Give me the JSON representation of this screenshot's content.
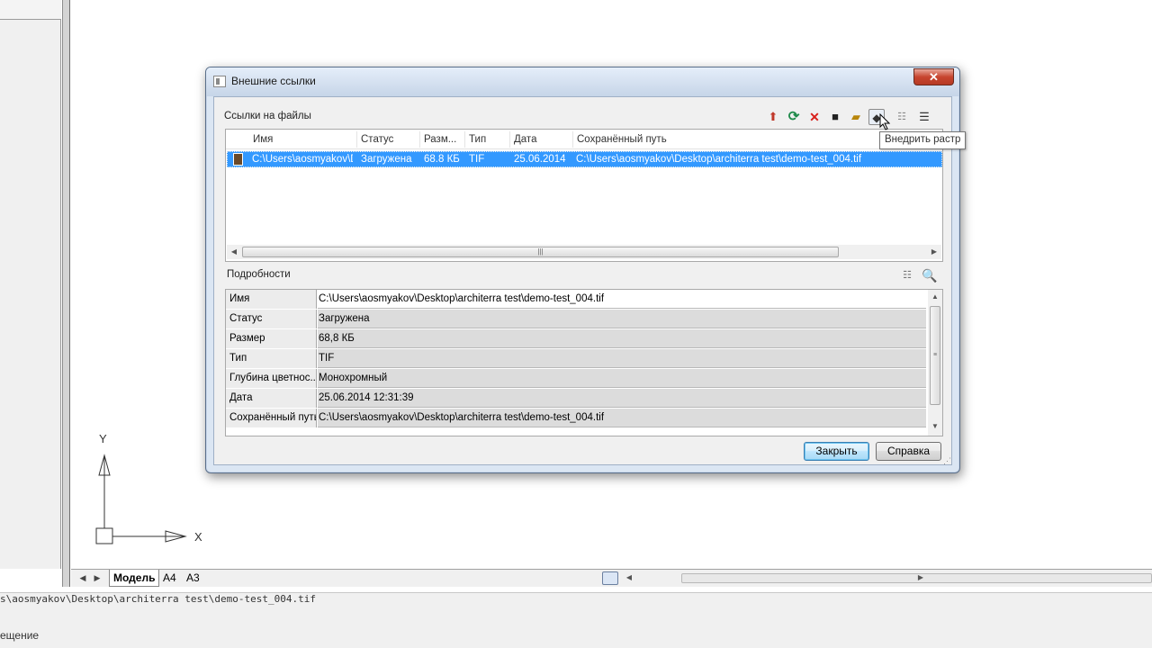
{
  "app": {
    "layout_tabs": [
      "Модель",
      "A4",
      "A3"
    ],
    "command_line": [
      "s\\aosmyakov\\Desktop\\architerra test\\demo-test_004.tif",
      "ещение"
    ],
    "ucs": {
      "x_label": "X",
      "y_label": "Y"
    }
  },
  "dialog": {
    "title": "Внешние ссылки",
    "close_glyph": "✕",
    "refs_section_label": "Ссылки на файлы",
    "toolbar_icons": [
      "attach-icon",
      "reload-icon",
      "delete-icon",
      "save-icon",
      "open-folder-icon",
      "embed-raster-icon",
      "list-view-icon",
      "tree-view-icon"
    ],
    "tooltip": "Внедрить растр",
    "file_list": {
      "columns": [
        "Имя",
        "Статус",
        "Разм...",
        "Тип",
        "Дата",
        "Сохранённый путь"
      ],
      "rows": [
        {
          "name": "C:\\Users\\aosmyakov\\D",
          "status": "Загружена",
          "size": "68.8 КБ",
          "type": "TIF",
          "date": "25.06.2014",
          "saved_path": "C:\\Users\\aosmyakov\\Desktop\\architerra test\\demo-test_004.tif",
          "selected": true
        }
      ]
    },
    "details_label": "Подробности",
    "details": [
      {
        "name": "Имя",
        "value": "C:\\Users\\aosmyakov\\Desktop\\architerra test\\demo-test_004.tif"
      },
      {
        "name": "Статус",
        "value": "Загружена"
      },
      {
        "name": "Размер",
        "value": "68,8 КБ"
      },
      {
        "name": "Тип",
        "value": "TIF"
      },
      {
        "name": "Глубина цветнос...",
        "value": "Монохромный"
      },
      {
        "name": "Дата",
        "value": "25.06.2014 12:31:39"
      },
      {
        "name": "Сохранённый путь",
        "value": "C:\\Users\\aosmyakov\\Desktop\\architerra test\\demo-test_004.tif"
      }
    ],
    "buttons": {
      "close": "Закрыть",
      "help": "Справка"
    },
    "colors": {
      "selection": "#3399ff",
      "close_button": "#c7452f"
    }
  }
}
